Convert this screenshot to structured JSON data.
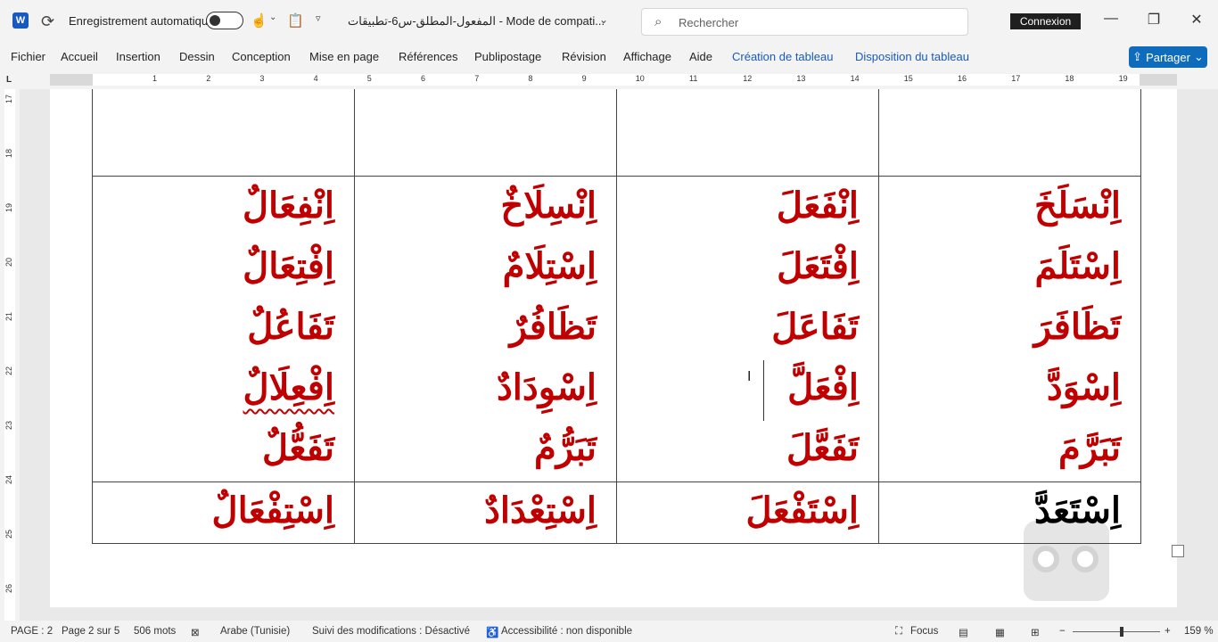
{
  "titlebar": {
    "autosave_label": "Enregistrement automatique",
    "doc_title": "المفعول-المطلق-س6-تطبيقات  -  Mode de compati...",
    "search_placeholder": "Rechercher",
    "signin": "Connexion"
  },
  "ribbon": {
    "tabs": [
      "Fichier",
      "Accueil",
      "Insertion",
      "Dessin",
      "Conception",
      "Mise en page",
      "Références",
      "Publipostage",
      "Révision",
      "Affichage",
      "Aide"
    ],
    "context_tabs": [
      "Création de tableau",
      "Disposition du tableau"
    ],
    "share": "Partager"
  },
  "ruler": {
    "h_numbers": [
      "1",
      "2",
      "3",
      "4",
      "5",
      "6",
      "7",
      "8",
      "9",
      "10",
      "11",
      "12",
      "13",
      "14",
      "15",
      "16",
      "17",
      "18",
      "19"
    ],
    "v_numbers": [
      "17",
      "18",
      "19",
      "20",
      "21",
      "22",
      "23",
      "24",
      "25",
      "26"
    ]
  },
  "table": {
    "rows": [
      [
        "",
        "",
        "",
        ""
      ],
      [
        [
          "اِنْسَلَخَ",
          "اِسْتَلَمَ",
          "تَظَافَرَ",
          "اِسْوَدَّ",
          "تَبَرَّمَ"
        ],
        [
          "اِنْفَعَلَ",
          "اِفْتَعَلَ",
          "تَفَاعَلَ",
          "اِفْعَلَّ",
          "تَفَعَّلَ"
        ],
        [
          "اِنْسِلَاخٌ",
          "اِسْتِلَامٌ",
          "تَظَافُرٌ",
          "اِسْوِدَادٌ",
          "تَبَرُّمٌ"
        ],
        [
          "اِنْفِعَالٌ",
          "اِفْتِعَالٌ",
          "تَفَاعُلٌ",
          "اِفْعِلَالٌ",
          "تَفَعُّلٌ"
        ]
      ],
      [
        "اِسْتَعَدَّ",
        "اِسْتَفْعَلَ",
        "اِسْتِعْدَادٌ",
        "اِسْتِفْعَالٌ"
      ]
    ]
  },
  "status": {
    "page": "PAGE : 2",
    "page_of": "Page 2 sur 5",
    "words": "506 mots",
    "language": "Arabe (Tunisie)",
    "tracking": "Suivi des modifications : Désactivé",
    "accessibility": "Accessibilité : non disponible",
    "focus": "Focus",
    "zoom": "159 %"
  },
  "colors": {
    "accent": "#185abd",
    "arabic_red": "#c00000",
    "share_bg": "#0f6cbd"
  }
}
